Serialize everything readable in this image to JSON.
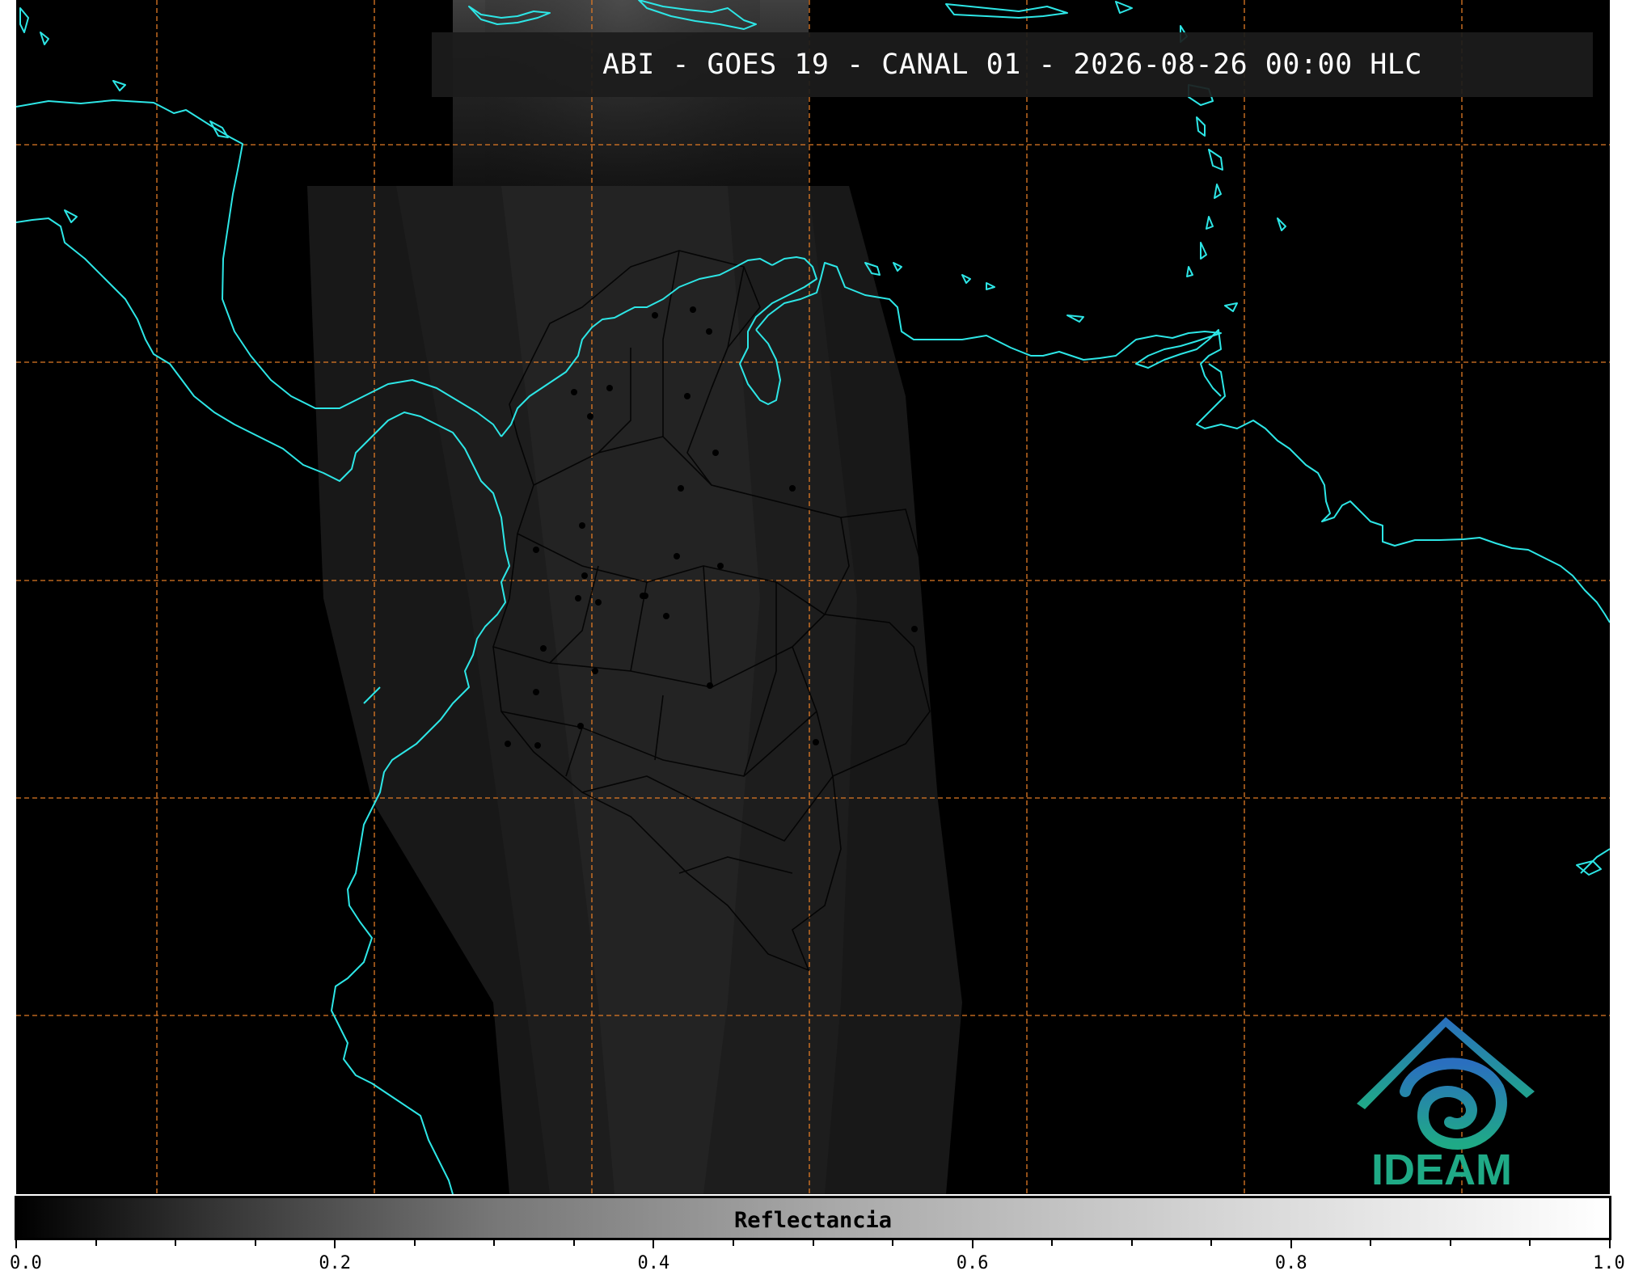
{
  "title": "ABI - GOES 19 - CANAL 01 - 2026-08-26 00:00 HLC",
  "logo": {
    "text": "IDEAM",
    "color": "#1faa86",
    "accent": "#2a6fbf"
  },
  "map": {
    "background": "#000000",
    "coastline_color": "#2de6e6",
    "border_color": "#000000",
    "grid_color": "#e07a25",
    "grid_style": "dashed"
  },
  "colorbar": {
    "label": "Reflectancia",
    "min": 0.0,
    "max": 1.0,
    "colormap": "gray",
    "ticks": [
      "0.0",
      "0.2",
      "0.4",
      "0.6",
      "0.8",
      "1.0"
    ],
    "minor_tick_step": 0.05
  }
}
